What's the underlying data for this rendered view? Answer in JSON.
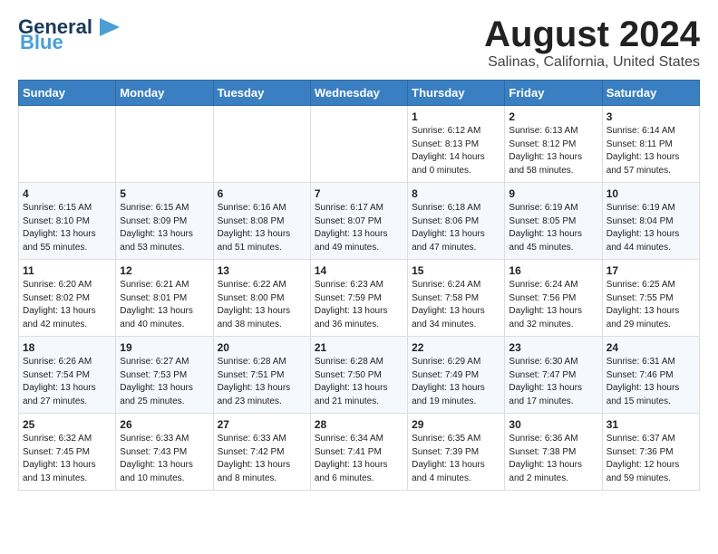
{
  "header": {
    "logo_main": "General",
    "logo_accent": "Blue",
    "title": "August 2024",
    "subtitle": "Salinas, California, United States"
  },
  "days_of_week": [
    "Sunday",
    "Monday",
    "Tuesday",
    "Wednesday",
    "Thursday",
    "Friday",
    "Saturday"
  ],
  "weeks": [
    [
      {
        "num": "",
        "info": ""
      },
      {
        "num": "",
        "info": ""
      },
      {
        "num": "",
        "info": ""
      },
      {
        "num": "",
        "info": ""
      },
      {
        "num": "1",
        "info": "Sunrise: 6:12 AM\nSunset: 8:13 PM\nDaylight: 14 hours\nand 0 minutes."
      },
      {
        "num": "2",
        "info": "Sunrise: 6:13 AM\nSunset: 8:12 PM\nDaylight: 13 hours\nand 58 minutes."
      },
      {
        "num": "3",
        "info": "Sunrise: 6:14 AM\nSunset: 8:11 PM\nDaylight: 13 hours\nand 57 minutes."
      }
    ],
    [
      {
        "num": "4",
        "info": "Sunrise: 6:15 AM\nSunset: 8:10 PM\nDaylight: 13 hours\nand 55 minutes."
      },
      {
        "num": "5",
        "info": "Sunrise: 6:15 AM\nSunset: 8:09 PM\nDaylight: 13 hours\nand 53 minutes."
      },
      {
        "num": "6",
        "info": "Sunrise: 6:16 AM\nSunset: 8:08 PM\nDaylight: 13 hours\nand 51 minutes."
      },
      {
        "num": "7",
        "info": "Sunrise: 6:17 AM\nSunset: 8:07 PM\nDaylight: 13 hours\nand 49 minutes."
      },
      {
        "num": "8",
        "info": "Sunrise: 6:18 AM\nSunset: 8:06 PM\nDaylight: 13 hours\nand 47 minutes."
      },
      {
        "num": "9",
        "info": "Sunrise: 6:19 AM\nSunset: 8:05 PM\nDaylight: 13 hours\nand 45 minutes."
      },
      {
        "num": "10",
        "info": "Sunrise: 6:19 AM\nSunset: 8:04 PM\nDaylight: 13 hours\nand 44 minutes."
      }
    ],
    [
      {
        "num": "11",
        "info": "Sunrise: 6:20 AM\nSunset: 8:02 PM\nDaylight: 13 hours\nand 42 minutes."
      },
      {
        "num": "12",
        "info": "Sunrise: 6:21 AM\nSunset: 8:01 PM\nDaylight: 13 hours\nand 40 minutes."
      },
      {
        "num": "13",
        "info": "Sunrise: 6:22 AM\nSunset: 8:00 PM\nDaylight: 13 hours\nand 38 minutes."
      },
      {
        "num": "14",
        "info": "Sunrise: 6:23 AM\nSunset: 7:59 PM\nDaylight: 13 hours\nand 36 minutes."
      },
      {
        "num": "15",
        "info": "Sunrise: 6:24 AM\nSunset: 7:58 PM\nDaylight: 13 hours\nand 34 minutes."
      },
      {
        "num": "16",
        "info": "Sunrise: 6:24 AM\nSunset: 7:56 PM\nDaylight: 13 hours\nand 32 minutes."
      },
      {
        "num": "17",
        "info": "Sunrise: 6:25 AM\nSunset: 7:55 PM\nDaylight: 13 hours\nand 29 minutes."
      }
    ],
    [
      {
        "num": "18",
        "info": "Sunrise: 6:26 AM\nSunset: 7:54 PM\nDaylight: 13 hours\nand 27 minutes."
      },
      {
        "num": "19",
        "info": "Sunrise: 6:27 AM\nSunset: 7:53 PM\nDaylight: 13 hours\nand 25 minutes."
      },
      {
        "num": "20",
        "info": "Sunrise: 6:28 AM\nSunset: 7:51 PM\nDaylight: 13 hours\nand 23 minutes."
      },
      {
        "num": "21",
        "info": "Sunrise: 6:28 AM\nSunset: 7:50 PM\nDaylight: 13 hours\nand 21 minutes."
      },
      {
        "num": "22",
        "info": "Sunrise: 6:29 AM\nSunset: 7:49 PM\nDaylight: 13 hours\nand 19 minutes."
      },
      {
        "num": "23",
        "info": "Sunrise: 6:30 AM\nSunset: 7:47 PM\nDaylight: 13 hours\nand 17 minutes."
      },
      {
        "num": "24",
        "info": "Sunrise: 6:31 AM\nSunset: 7:46 PM\nDaylight: 13 hours\nand 15 minutes."
      }
    ],
    [
      {
        "num": "25",
        "info": "Sunrise: 6:32 AM\nSunset: 7:45 PM\nDaylight: 13 hours\nand 13 minutes."
      },
      {
        "num": "26",
        "info": "Sunrise: 6:33 AM\nSunset: 7:43 PM\nDaylight: 13 hours\nand 10 minutes."
      },
      {
        "num": "27",
        "info": "Sunrise: 6:33 AM\nSunset: 7:42 PM\nDaylight: 13 hours\nand 8 minutes."
      },
      {
        "num": "28",
        "info": "Sunrise: 6:34 AM\nSunset: 7:41 PM\nDaylight: 13 hours\nand 6 minutes."
      },
      {
        "num": "29",
        "info": "Sunrise: 6:35 AM\nSunset: 7:39 PM\nDaylight: 13 hours\nand 4 minutes."
      },
      {
        "num": "30",
        "info": "Sunrise: 6:36 AM\nSunset: 7:38 PM\nDaylight: 13 hours\nand 2 minutes."
      },
      {
        "num": "31",
        "info": "Sunrise: 6:37 AM\nSunset: 7:36 PM\nDaylight: 12 hours\nand 59 minutes."
      }
    ]
  ]
}
